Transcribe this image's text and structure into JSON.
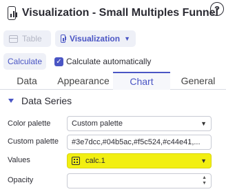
{
  "header": {
    "title": "Visualization - Small Multiples Funnel",
    "help_icon": "?"
  },
  "mode": {
    "table_label": "Table",
    "visualization_label": "Visualization"
  },
  "calc": {
    "button_label": "Calculate",
    "auto_label": "Calculate automatically",
    "auto_checked": true
  },
  "tabs": [
    {
      "label": "Data",
      "active": false
    },
    {
      "label": "Appearance",
      "active": false
    },
    {
      "label": "Chart",
      "active": true
    },
    {
      "label": "General",
      "active": false
    }
  ],
  "section": {
    "title": "Data Series"
  },
  "fields": {
    "color_palette": {
      "label": "Color palette",
      "value": "Custom palette"
    },
    "custom_palette": {
      "label": "Custom palette",
      "value": "#3e7dcc,#04b5ac,#f5c524,#c44e41,..."
    },
    "values": {
      "label": "Values",
      "value": "calc.1"
    },
    "opacity": {
      "label": "Opacity",
      "value": ""
    }
  },
  "colors": {
    "accent": "#4a55c4",
    "highlight": "#f2ef12"
  }
}
